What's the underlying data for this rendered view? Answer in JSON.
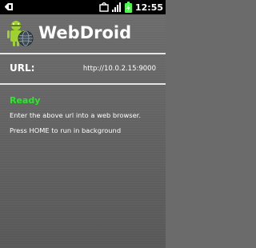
{
  "statusbar": {
    "time": "12:55",
    "icons": [
      "usb-debug-icon",
      "notification-icon",
      "signal-icon",
      "battery-icon"
    ]
  },
  "header": {
    "title": "WebDroid",
    "icon": "android-globe-icon"
  },
  "url": {
    "label": "URL:",
    "value": "http://10.0.2.15:9000"
  },
  "status": {
    "text": "Ready",
    "color": "#22ee22"
  },
  "messages": {
    "line1": "Enter the above url into a web browser.",
    "line2": "Press HOME to run in background"
  }
}
